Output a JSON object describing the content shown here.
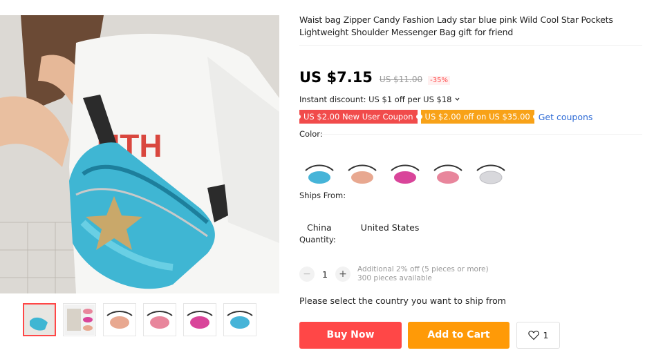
{
  "product": {
    "title": "Waist bag Zipper Candy Fashion Lady star blue pink Wild Cool Star Pockets Lightweight Shoulder Messenger Bag gift for friend",
    "price": "US $7.15",
    "original_price": "US $11.00",
    "discount_badge": "-35%"
  },
  "promo": {
    "instant_discount": "Instant discount: US $1 off per US $18",
    "coupons": [
      "US $2.00 New User Coupon",
      "US $2.00 off on US $35.00"
    ],
    "get_coupons": "Get coupons"
  },
  "options": {
    "color_label": "Color:",
    "colors": [
      {
        "name": "blue",
        "hex": "#46b4d8"
      },
      {
        "name": "peach",
        "hex": "#e8a890"
      },
      {
        "name": "magenta",
        "hex": "#d9459a"
      },
      {
        "name": "pink",
        "hex": "#e8869c"
      },
      {
        "name": "silver",
        "hex": "#d8d8dc"
      }
    ],
    "ships_from_label": "Ships From:",
    "ships_from": [
      "China",
      "United States"
    ]
  },
  "quantity": {
    "label": "Quantity:",
    "minus": "−",
    "plus": "+",
    "value": "1",
    "note_line1": "Additional 2% off (5 pieces or more)",
    "note_line2": "300 pieces available"
  },
  "ship_message": "Please select the country you want to ship from",
  "actions": {
    "buy_now": "Buy Now",
    "add_to_cart": "Add to Cart",
    "wishlist_count": "1"
  },
  "colors": {
    "accent_red": "#ff4747",
    "accent_orange": "#ff9a07",
    "link_blue": "#2e6bd6"
  }
}
